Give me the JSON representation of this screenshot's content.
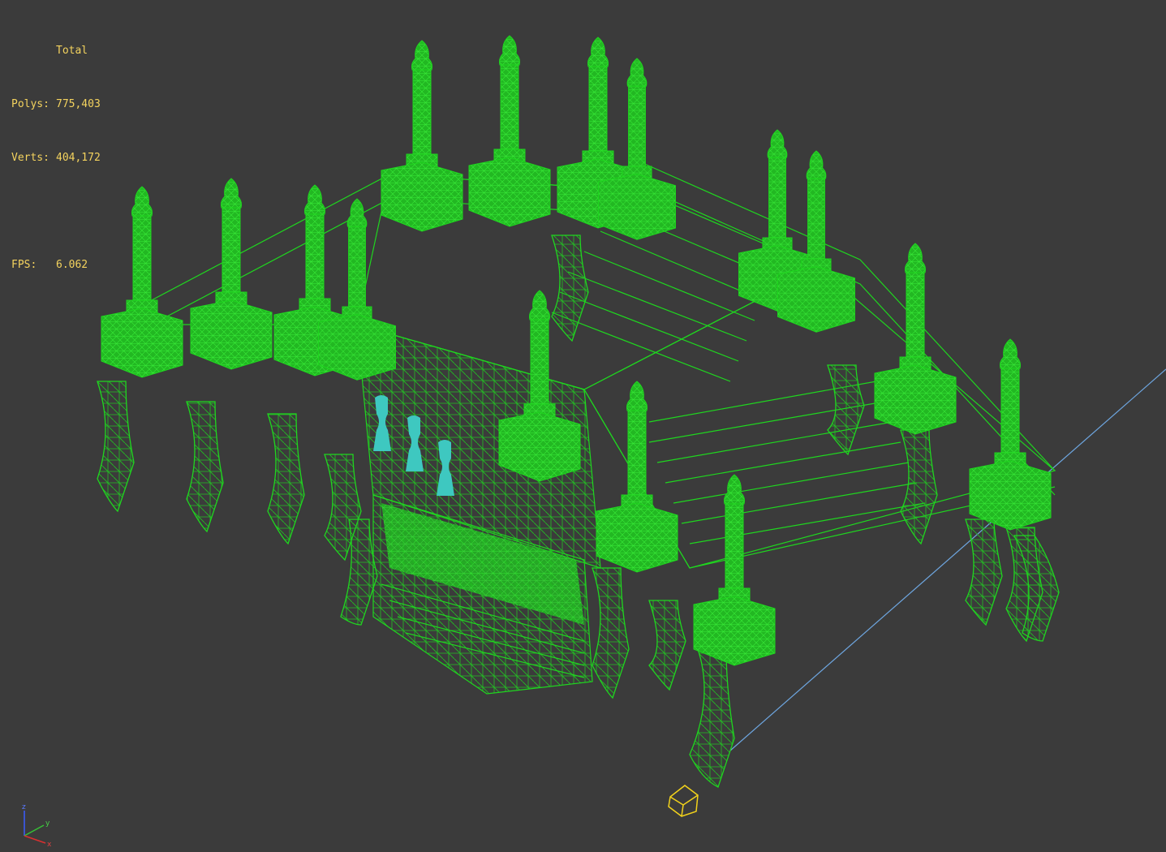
{
  "stats": {
    "header": "Total",
    "polys_label": "Polys:",
    "polys_value": "775,403",
    "verts_label": "Verts:",
    "verts_value": "404,172",
    "fps_label": "FPS:",
    "fps_value": "6.062"
  },
  "gizmo": {
    "z_label": "z",
    "y_label": "y",
    "x_label": "x"
  },
  "colors": {
    "viewport_bg": "#3b3b3b",
    "wire_green": "#1fd61f",
    "wire_fill": "#22b822",
    "selection_cyan": "#3ec8c0",
    "stats_text": "#f4d35e",
    "grid_line": "#6ea6e0",
    "camera_gizmo": "#f2d21b"
  }
}
